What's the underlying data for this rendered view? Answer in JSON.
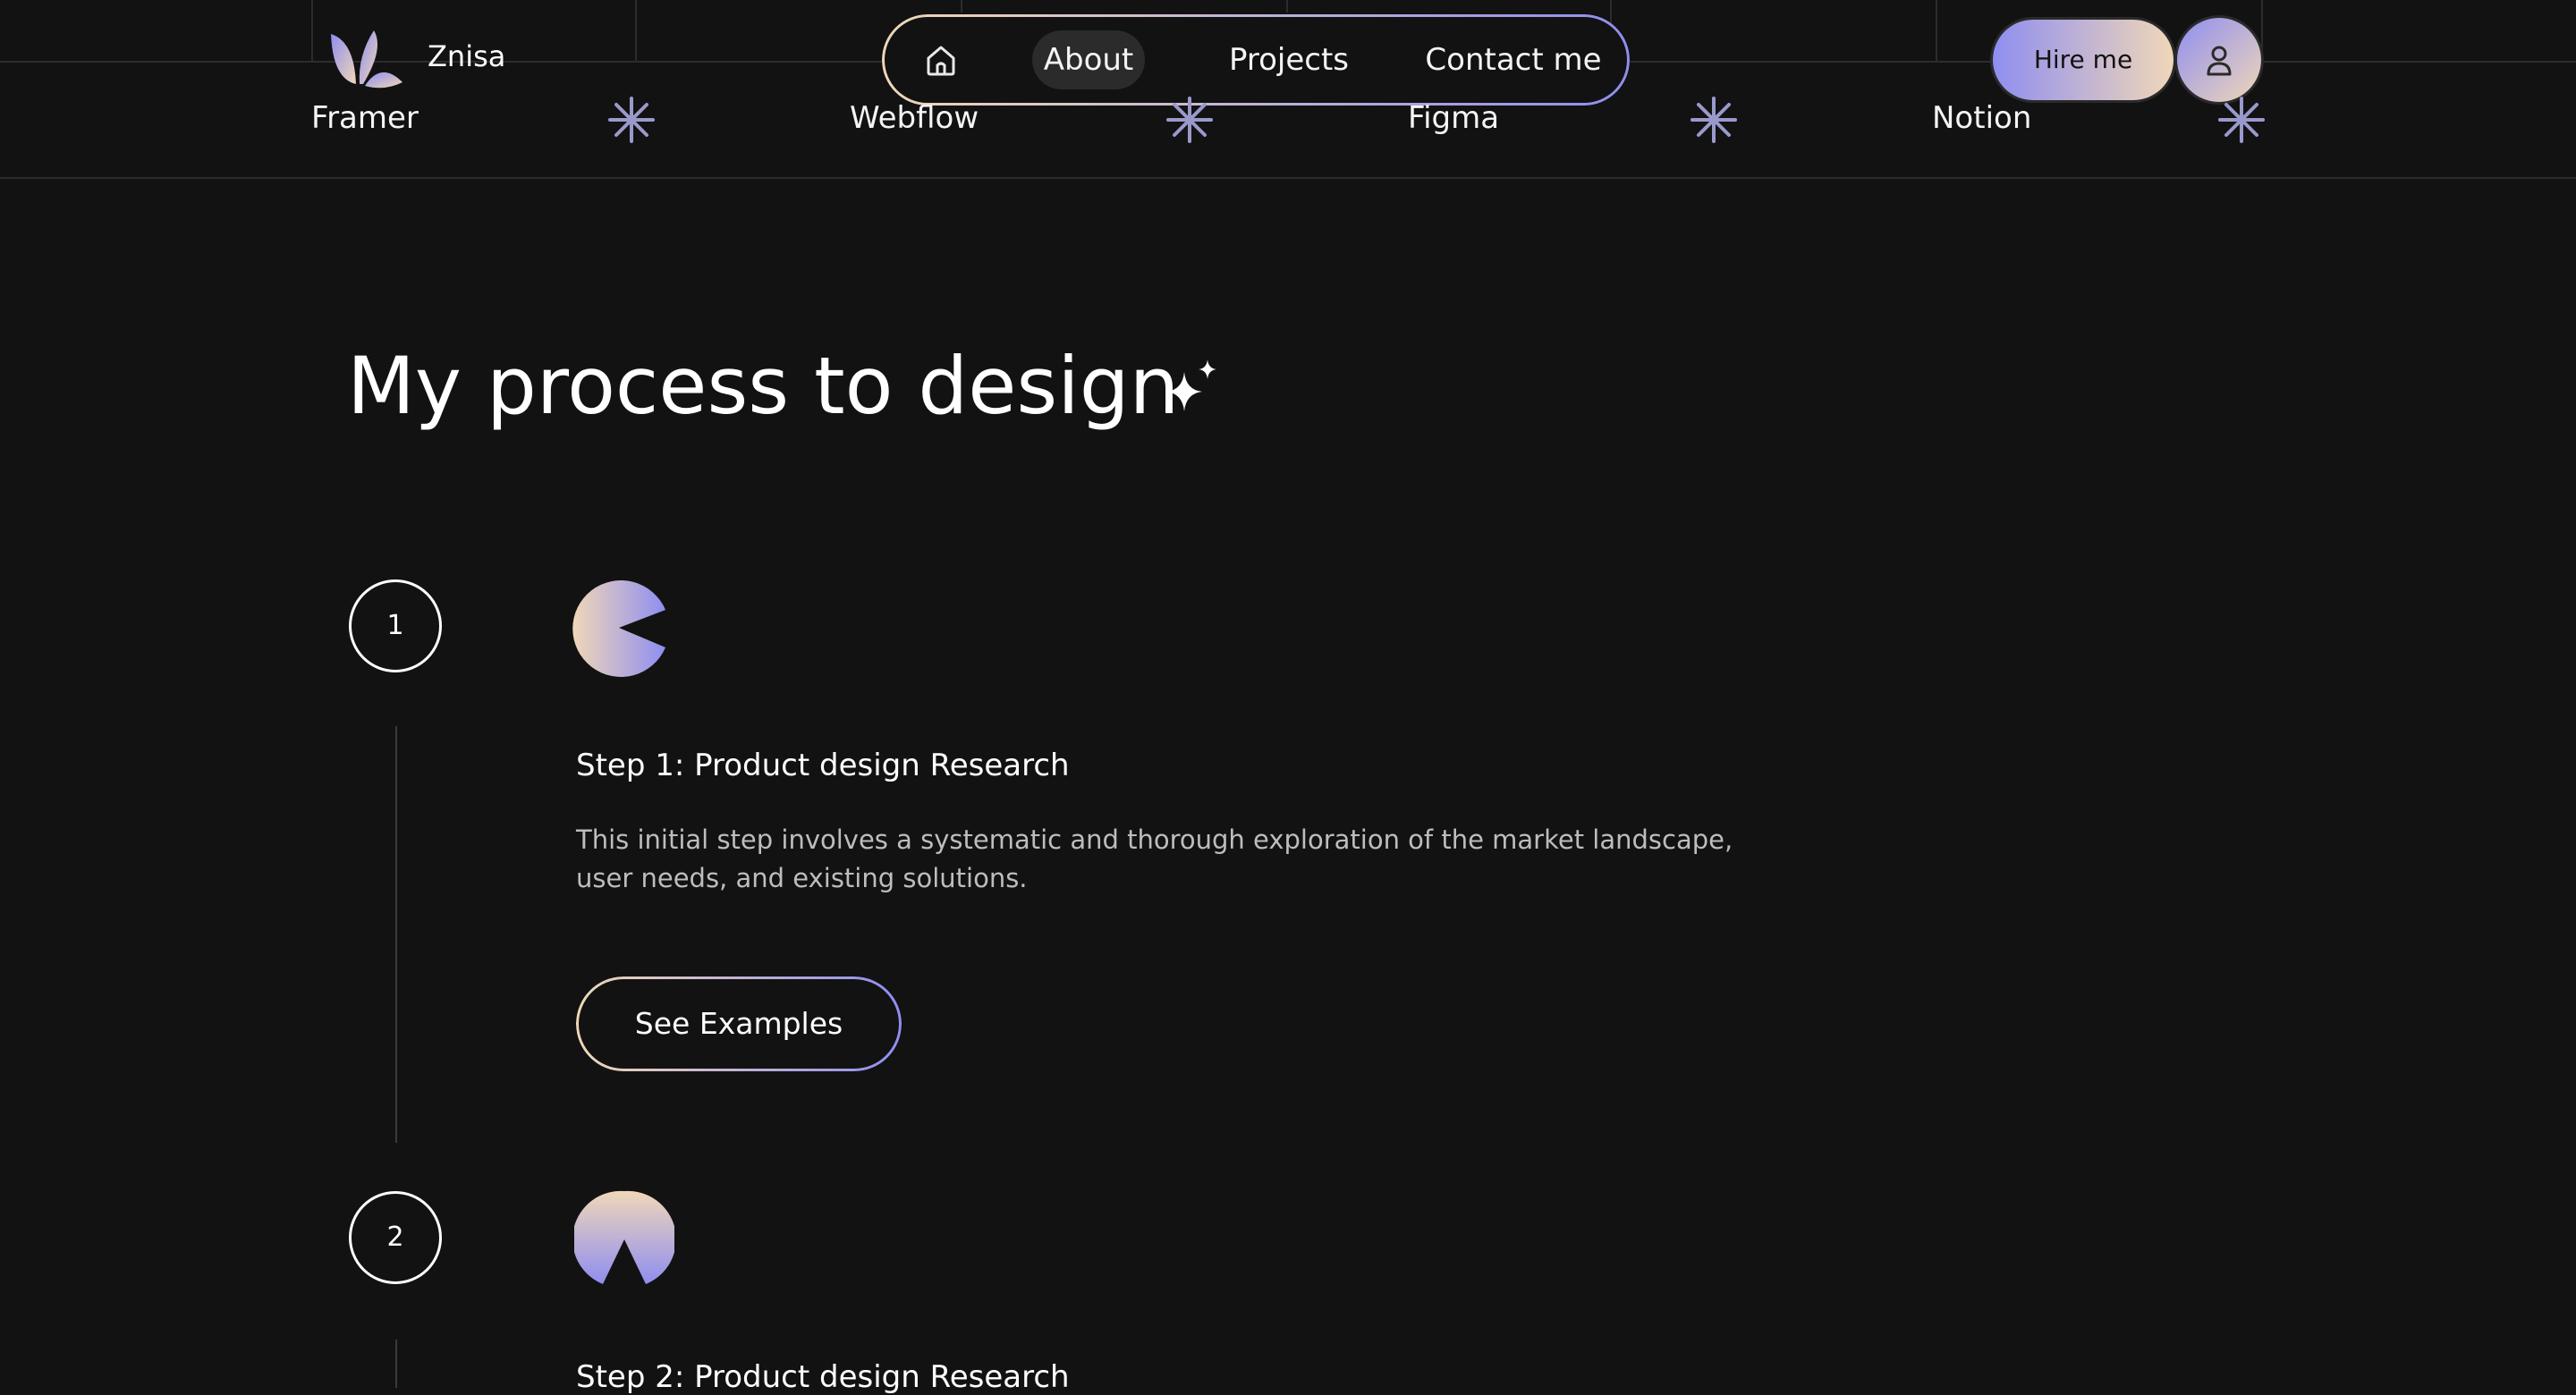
{
  "header": {
    "brand": "Znisa",
    "nav": {
      "home_icon": "home-icon",
      "items": [
        "About",
        "Projects",
        "Contact me"
      ],
      "active": "About"
    },
    "hire_label": "Hire me",
    "user_icon": "user-icon"
  },
  "tools": [
    "Framer",
    "Webflow",
    "Figma",
    "Notion"
  ],
  "main": {
    "heading": "My process to design",
    "steps": [
      {
        "number": "1",
        "title": "Step 1: Product design Research",
        "description": "This initial step involves a systematic and thorough exploration of the market landscape, user needs, and existing solutions.",
        "button": "See Examples"
      },
      {
        "number": "2",
        "title": "Step 2: Product design Research"
      }
    ]
  },
  "colors": {
    "background": "#121212",
    "gradient_peach": "#f0d7b8",
    "gradient_lavender": "#8f8ef0",
    "text_muted": "#bdbdbd",
    "active_pill": "#2b2b2b"
  }
}
